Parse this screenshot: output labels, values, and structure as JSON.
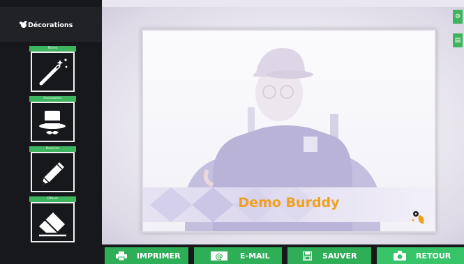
{
  "sidebar": {
    "title": "Décorations",
    "tools": [
      {
        "label": "Filtres",
        "icon": "magic-wand-icon"
      },
      {
        "label": "Accessoires",
        "icon": "top-hat-mustache-icon"
      },
      {
        "label": "Dessiner",
        "icon": "pencil-icon"
      },
      {
        "label": "Effacer",
        "icon": "eraser-icon"
      }
    ]
  },
  "photo": {
    "banner_text": "Demo Burddy"
  },
  "toolbar": {
    "print_label": "IMPRIMER",
    "email_label": "E-MAIL",
    "save_label": "SAUVER",
    "back_label": "RETOUR"
  },
  "colors": {
    "accent_green": "#3fb45f",
    "banner_orange": "#f0a020",
    "sidebar_bg": "#17181b"
  }
}
